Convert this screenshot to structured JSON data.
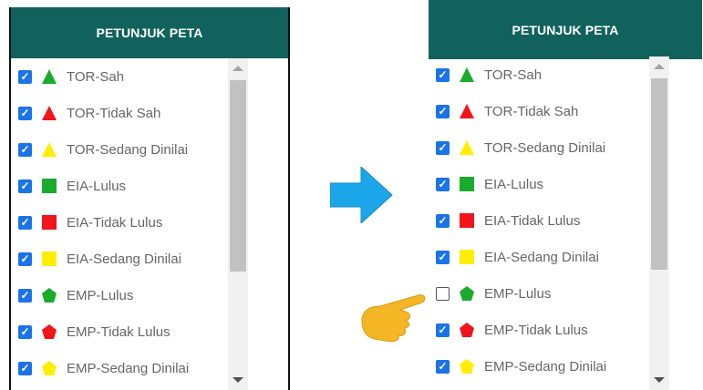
{
  "before": {
    "header": "PETUNJUK PETA",
    "items": [
      {
        "label": "TOR-Sah",
        "icon": "green-triangle-icon",
        "checked": true
      },
      {
        "label": "TOR-Tidak Sah",
        "icon": "red-triangle-icon",
        "checked": true
      },
      {
        "label": "TOR-Sedang Dinilai",
        "icon": "yellow-triangle-icon",
        "checked": true
      },
      {
        "label": "EIA-Lulus",
        "icon": "green-square-icon",
        "checked": true
      },
      {
        "label": "EIA-Tidak Lulus",
        "icon": "red-square-icon",
        "checked": true
      },
      {
        "label": "EIA-Sedang Dinilai",
        "icon": "yellow-square-icon",
        "checked": true
      },
      {
        "label": "EMP-Lulus",
        "icon": "green-pentagon-icon",
        "checked": true
      },
      {
        "label": "EMP-Tidak Lulus",
        "icon": "red-pentagon-icon",
        "checked": true
      },
      {
        "label": "EMP-Sedang Dinilai",
        "icon": "yellow-pentagon-icon",
        "checked": true
      }
    ]
  },
  "after": {
    "header": "PETUNJUK PETA",
    "items": [
      {
        "label": "TOR-Sah",
        "icon": "green-triangle-icon",
        "checked": true
      },
      {
        "label": "TOR-Tidak Sah",
        "icon": "red-triangle-icon",
        "checked": true
      },
      {
        "label": "TOR-Sedang Dinilai",
        "icon": "yellow-triangle-icon",
        "checked": true
      },
      {
        "label": "EIA-Lulus",
        "icon": "green-square-icon",
        "checked": true
      },
      {
        "label": "EIA-Tidak Lulus",
        "icon": "red-square-icon",
        "checked": true
      },
      {
        "label": "EIA-Sedang Dinilai",
        "icon": "yellow-square-icon",
        "checked": true
      },
      {
        "label": "EMP-Lulus",
        "icon": "green-pentagon-icon",
        "checked": false
      },
      {
        "label": "EMP-Tidak Lulus",
        "icon": "red-pentagon-icon",
        "checked": true
      },
      {
        "label": "EMP-Sedang Dinilai",
        "icon": "yellow-pentagon-icon",
        "checked": true
      }
    ]
  },
  "colors": {
    "header_bg": "#11625c",
    "green": "#1aab2c",
    "red": "#f0151b",
    "yellow": "#ffee00",
    "checkbox": "#1a73e8",
    "arrow": "#1aa6e8",
    "hand": "#f5b625"
  }
}
